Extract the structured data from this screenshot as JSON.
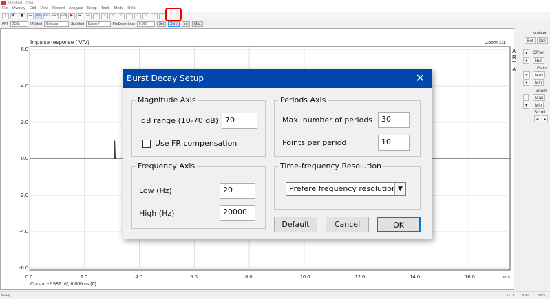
{
  "window": {
    "title": "Untitled - Arta"
  },
  "menu": [
    "File",
    "Overlay",
    "Edit",
    "View",
    "Record",
    "Analysis",
    "Setup",
    "Tools",
    "Mode",
    "Help"
  ],
  "toolbar": {
    "buttons": [
      "new",
      "open",
      "stop",
      "gen",
      "IMP",
      "FR2",
      "FR1",
      "SPA",
      "record",
      "probe",
      "scope",
      "ir1",
      "ir2",
      "ir3",
      "bd1",
      "bd2",
      "bd3",
      "bd4",
      "burst-decay",
      "extra"
    ],
    "highlighted_button": "burst-decay",
    "highlight_color": "#e00000"
  },
  "toolbar2": {
    "fft_label": "FFT",
    "fft_value": "256k",
    "irwnd_label": "IR Wnd",
    "irwnd_value": "Uniform",
    "sigwnd_label": "Sig Wnd",
    "sigwnd_value": "Kaiser7",
    "predelay_label": "PreDelay (ms)",
    "predelay_value": "0.000",
    "set": "Set",
    "zero": "Zero",
    "inv": "Inv",
    "max": "Max"
  },
  "plot": {
    "title": "Impulse response  ( V/V)",
    "zoom": "Zoom 1:1",
    "brand": [
      "A",
      "R",
      "T",
      "A"
    ],
    "cursor": "Cursor: -2.582 uV, 0.000ms (0)",
    "x_unit": "ms"
  },
  "chart_data": {
    "type": "line",
    "xlabel": "ms",
    "ylabel": "Impulse response (V/V)",
    "xlim": [
      0,
      17.5
    ],
    "ylim": [
      -6,
      6
    ],
    "xticks": [
      "0.0",
      "2.0",
      "4.0",
      "6.0",
      "8.0",
      "10.0",
      "12.0",
      "14.0",
      "16.0"
    ],
    "yticks": [
      "6.0",
      "4.0",
      "2.0",
      "0.0",
      "-2.0",
      "-4.0",
      "-6.0"
    ],
    "series": [
      {
        "name": "impulse",
        "x": [
          0,
          3.1,
          3.1,
          3.12,
          17.5
        ],
        "y": [
          0,
          0,
          1.0,
          0,
          0
        ]
      }
    ]
  },
  "right_panel": {
    "marker": "Marker",
    "set": "Set",
    "del": "Del",
    "offset": "Offset",
    "null": "Null",
    "gain": "Gain",
    "gain_max": "Max",
    "gain_min": "Min",
    "zoom": "Zoom",
    "zoom_max": "Max",
    "zoom_min": "Min",
    "scroll": "Scroll"
  },
  "status": {
    "left": "Ready",
    "l": "L-1.0",
    "r": "R-3.0",
    "unit": "dBFS"
  },
  "dialog": {
    "title": "Burst Decay Setup",
    "magnitude": {
      "label": "Magnitude Axis",
      "db_range_label": "dB range (10-70 dB)",
      "db_range": "70",
      "use_fr_label": "Use FR compensation",
      "use_fr": false
    },
    "frequency": {
      "label": "Frequency Axis",
      "low_label": "Low (Hz)",
      "low": "20",
      "high_label": "High (Hz)",
      "high": "20000"
    },
    "periods": {
      "label": "Periods Axis",
      "max_label": "Max. number of periods",
      "max": "30",
      "points_label": "Points per period",
      "points": "10"
    },
    "resolution": {
      "label": "Time-frequency Resolution",
      "value": "Prefere frequency resolution"
    },
    "buttons": {
      "default": "Default",
      "cancel": "Cancel",
      "ok": "OK"
    }
  }
}
